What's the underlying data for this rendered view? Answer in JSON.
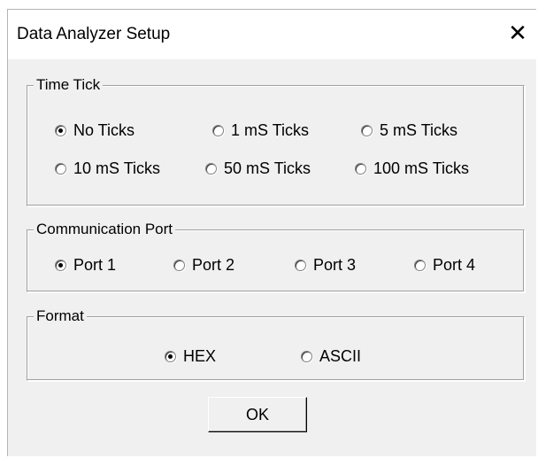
{
  "window": {
    "title": "Data Analyzer Setup",
    "close_glyph": "✕"
  },
  "time_tick": {
    "legend": "Time Tick",
    "options": [
      "No Ticks",
      "1 mS Ticks",
      "5 mS Ticks",
      "10 mS Ticks",
      "50 mS Ticks",
      "100 mS Ticks"
    ],
    "selected": "No Ticks"
  },
  "comm_port": {
    "legend": "Communication Port",
    "options": [
      "Port 1",
      "Port 2",
      "Port 3",
      "Port 4"
    ],
    "selected": "Port 1"
  },
  "format": {
    "legend": "Format",
    "options": [
      "HEX",
      "ASCII"
    ],
    "selected": "HEX"
  },
  "buttons": {
    "ok_label": "OK"
  }
}
